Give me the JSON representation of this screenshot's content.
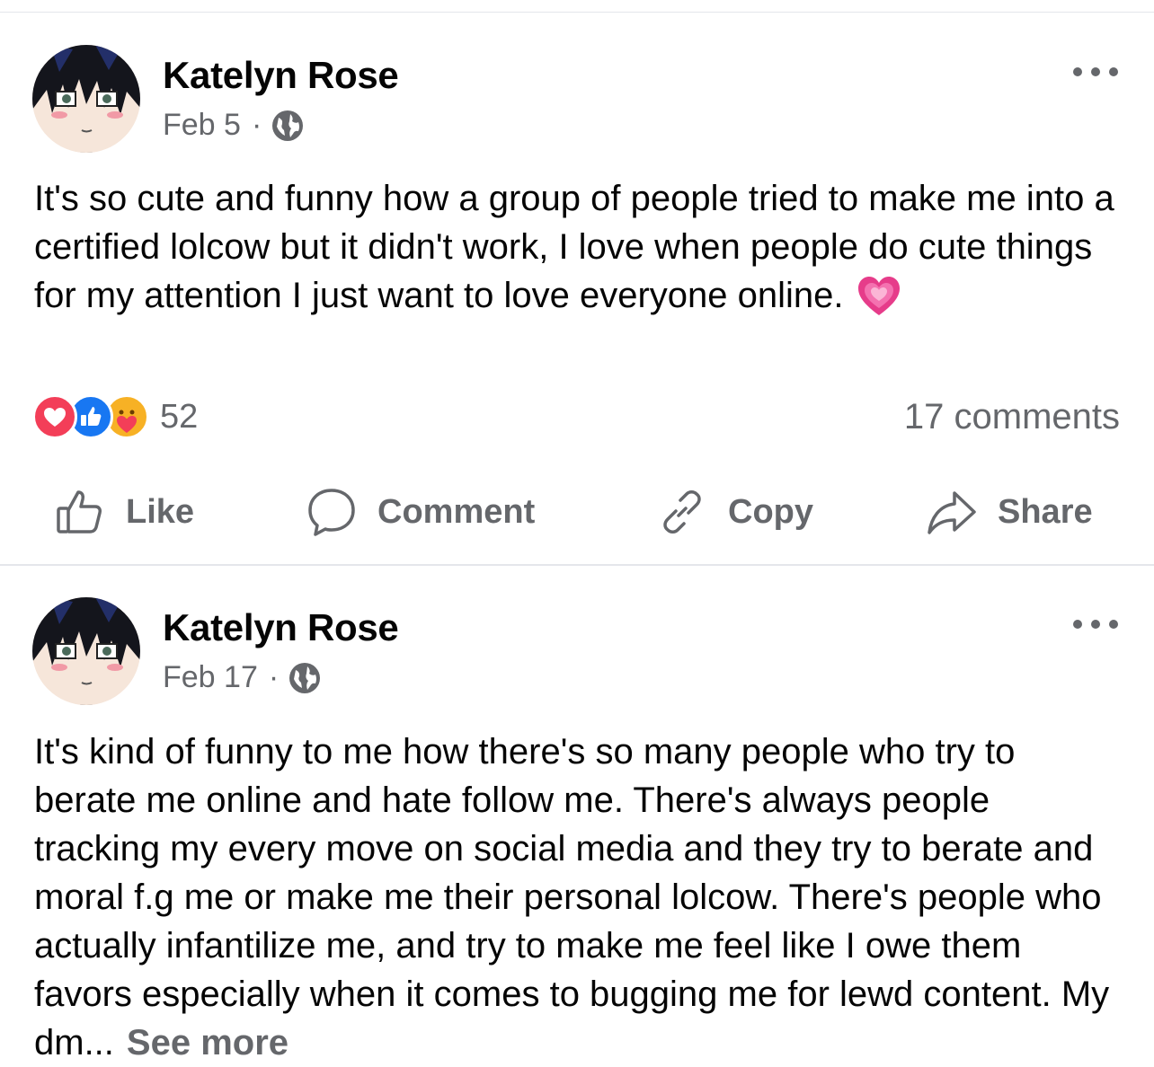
{
  "feed": {
    "posts": [
      {
        "author": "Katelyn Rose",
        "date": "Feb 5",
        "separator": "·",
        "text": "It's so cute and funny how a group of people tried to make me into a certified lolcow but it didn't work, I love when people do cute things for my attention I just want to love everyone online.",
        "emoji": "growing-heart",
        "reaction_icons": [
          "love-reaction",
          "like-reaction",
          "care-reaction"
        ],
        "reaction_count": "52",
        "comments": "17 comments",
        "actions": {
          "like": "Like",
          "comment": "Comment",
          "copy": "Copy",
          "share": "Share"
        }
      },
      {
        "author": "Katelyn Rose",
        "date": "Feb 17",
        "separator": "·",
        "text": "It's kind of funny to me how there's so many people who try to berate me online and hate follow me. There's always people tracking my every move on social media and they try to berate and moral f.g me or make me their personal lolcow. There's people who actually infantilize me, and try to make me feel like I owe them favors especially when it comes to bugging me for lewd content. My dm...",
        "see_more": "See more"
      }
    ]
  },
  "colors": {
    "secondary_text": "#65676b",
    "primary_text": "#050505",
    "like_blue": "#1877f2",
    "love_red": "#f33e58",
    "care_yellow": "#f7b125",
    "divider": "#e4e6eb"
  }
}
